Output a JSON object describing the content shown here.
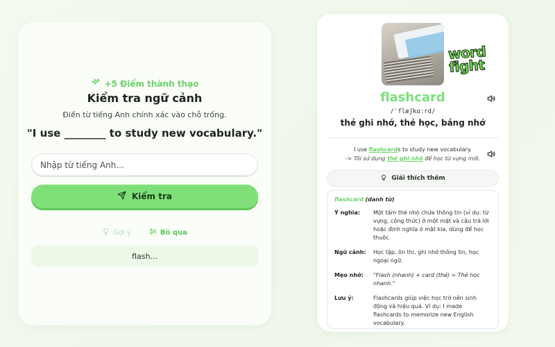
{
  "quiz": {
    "points": "+5 Điểm thành thạo",
    "title": "Kiểm tra ngữ cảnh",
    "instruction": "Điền từ tiếng Anh chính xác vào chỗ trống.",
    "sentence": "\"I use ________ to study new vocabulary.\"",
    "input_placeholder": "Nhập từ tiếng Anh...",
    "check_label": "Kiểm tra",
    "hint_label": "Gợi ý",
    "skip_label": "Bỏ qua",
    "hint_text": "flash..."
  },
  "card": {
    "logo_line1": "word",
    "logo_line2": "fight",
    "word": "flashcard",
    "phonetic": "/ˈflæʃkɑːrd/",
    "meaning": "thẻ ghi nhớ, thẻ học, bảng nhớ",
    "example_en_before": "I use ",
    "example_en_word": "flashcard",
    "example_en_after": "s to study new vocabulary.",
    "example_vi_before": "-> Tôi sử dụng ",
    "example_vi_word": "thẻ ghi nhớ",
    "example_vi_after": " để học từ vựng mới.",
    "explain_label": "Giải thích thêm",
    "detail": {
      "word": "flashcard",
      "pos": "(danh từ)",
      "rows": [
        {
          "label": "Ý nghĩa:",
          "value": "Một tấm thẻ nhỏ chứa thông tin (ví dụ: từ vựng, công thức) ở một mặt và câu trả lời hoặc định nghĩa ở mặt kia, dùng để học thuộc."
        },
        {
          "label": "Ngữ cảnh:",
          "value": "Học tập, ôn thi, ghi nhớ thông tin, học ngoại ngữ."
        },
        {
          "label": "Mẹo nhớ:",
          "value": "\"Flash (nhanh) + card (thẻ) = Thẻ học nhanh.\""
        },
        {
          "label": "Lưu ý:",
          "value": "Flashcards giúp việc học trở nên sinh động và hiệu quả. Ví dụ: I made flashcards to memorize new English vocabulary."
        }
      ]
    }
  },
  "colors": {
    "accent": "#7be07a",
    "accent_dark": "#58c657",
    "text": "#1d231d"
  },
  "icons": [
    "sparkle-icon",
    "send-icon",
    "lightbulb-icon",
    "skip-forward-icon",
    "speaker-icon"
  ]
}
